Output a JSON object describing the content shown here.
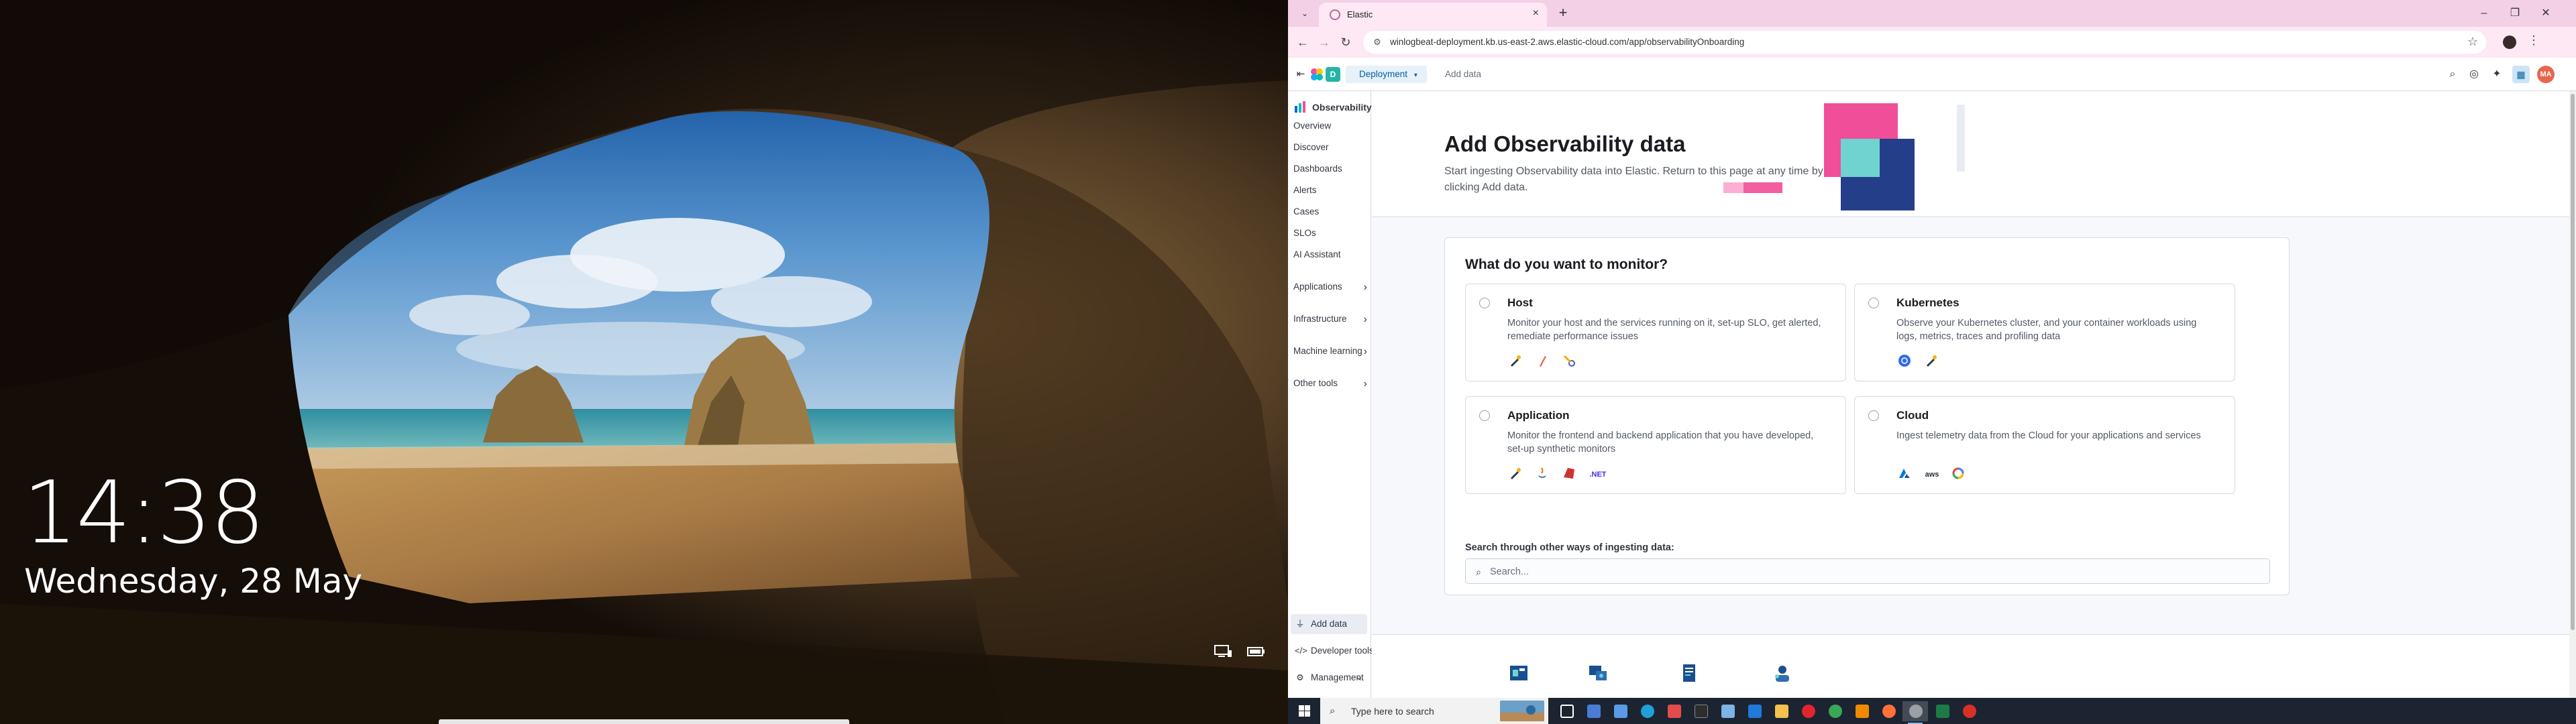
{
  "lock_screen": {
    "time": "14:38",
    "date": "Wednesday, 28 May",
    "icons": [
      "network-icon",
      "battery-icon"
    ]
  },
  "browser": {
    "tab": {
      "title": "Elastic"
    },
    "url": "winlogbeat-deployment.kb.us-east-2.aws.elastic-cloud.com/app/observabilityOnboarding",
    "window_controls": {
      "minimize": "–",
      "maximize": "❐",
      "close": "✕"
    }
  },
  "kibana": {
    "breadcrumb": {
      "deployment": "Deployment",
      "current": "Add data"
    },
    "user_initials": "MA",
    "sidebar": {
      "brand": "Observability",
      "items": [
        {
          "label": "Overview"
        },
        {
          "label": "Discover"
        },
        {
          "label": "Dashboards"
        },
        {
          "label": "Alerts"
        },
        {
          "label": "Cases"
        },
        {
          "label": "SLOs"
        },
        {
          "label": "AI Assistant"
        }
      ],
      "groups": [
        {
          "label": "Applications"
        },
        {
          "label": "Infrastructure"
        },
        {
          "label": "Machine learning"
        },
        {
          "label": "Other tools"
        }
      ],
      "bottom": [
        {
          "label": "Add data",
          "active": true
        },
        {
          "label": "Developer tools"
        },
        {
          "label": "Management"
        }
      ]
    },
    "hero": {
      "title": "Add Observability data",
      "description": "Start ingesting Observability data into Elastic. Return to this page at any time by clicking Add data."
    },
    "panel": {
      "title": "What do you want to monitor?",
      "cards": [
        {
          "title": "Host",
          "description": "Monitor your host and the services running on it, set-up SLO, get alerted, remediate performance issues",
          "logos": [
            "elastic-agent-logo",
            "integrations-logo",
            "opentelemetry-logo"
          ]
        },
        {
          "title": "Kubernetes",
          "description": "Observe your Kubernetes cluster, and your container workloads using logs, metrics, traces and profiling data",
          "logos": [
            "kubernetes-logo",
            "elastic-agent-logo"
          ]
        },
        {
          "title": "Application",
          "description": "Monitor the frontend and backend application that you have developed, set-up synthetic monitors",
          "logos": [
            "elastic-agent-logo",
            "java-logo",
            "ruby-logo",
            "dotnet-logo"
          ],
          "dotnet_label": ".NET"
        },
        {
          "title": "Cloud",
          "description": "Ingest telemetry data from the Cloud for your applications and services",
          "logos": [
            "azure-logo",
            "aws-logo",
            "gcp-logo"
          ],
          "aws_label": "aws"
        }
      ],
      "search": {
        "label": "Search through other ways of ingesting data:",
        "placeholder": "Search..."
      }
    }
  },
  "taskbar": {
    "search_placeholder": "Type here to search"
  },
  "colors": {
    "accent": "#0061a6",
    "tabstrip": "#f3d0e6",
    "toolbar": "#fde8f4",
    "taskbar": "#1b2430"
  }
}
